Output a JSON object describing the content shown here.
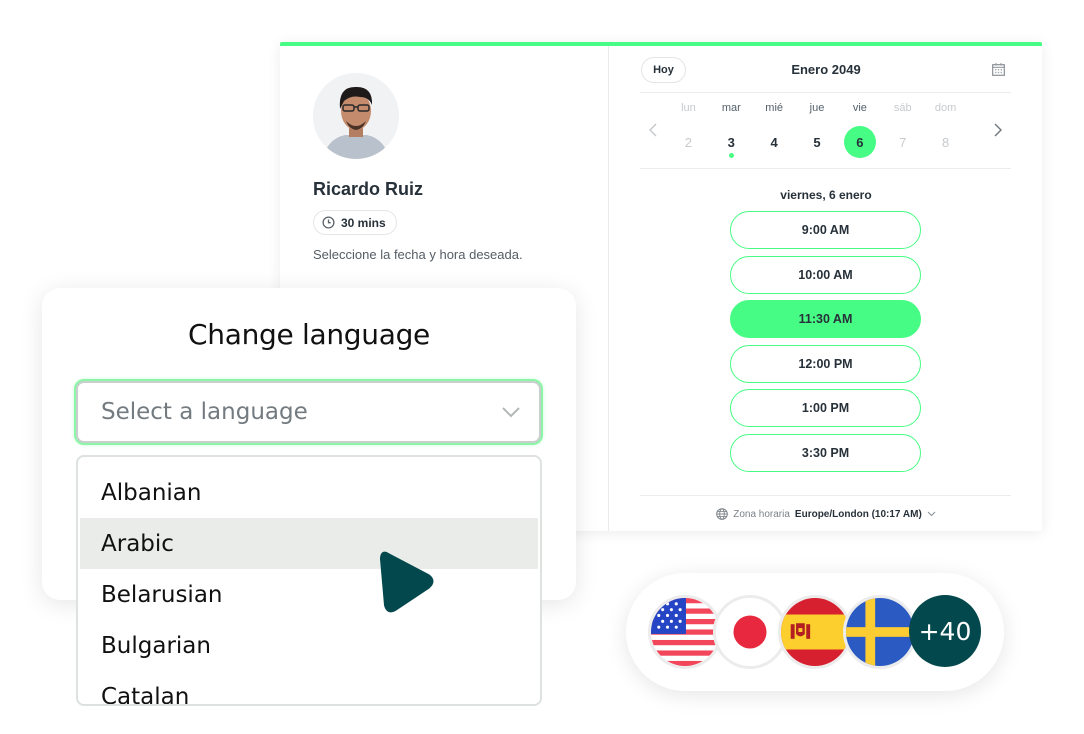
{
  "booking": {
    "host_name": "Ricardo Ruiz",
    "duration": "30 mins",
    "instructions": "Seleccione la fecha y hora deseada.",
    "today_label": "Hoy",
    "month_title": "Enero 2049",
    "week": [
      {
        "name": "lun",
        "num": "2",
        "state": "disabled"
      },
      {
        "name": "mar",
        "num": "3",
        "state": "today"
      },
      {
        "name": "mié",
        "num": "4",
        "state": "available"
      },
      {
        "name": "jue",
        "num": "5",
        "state": "available"
      },
      {
        "name": "vie",
        "num": "6",
        "state": "selected"
      },
      {
        "name": "sáb",
        "num": "7",
        "state": "disabled"
      },
      {
        "name": "dom",
        "num": "8",
        "state": "disabled"
      }
    ],
    "selected_date": "viernes, 6 enero",
    "slots": [
      {
        "label": "9:00 AM",
        "selected": false
      },
      {
        "label": "10:00 AM",
        "selected": false
      },
      {
        "label": "11:30 AM",
        "selected": true
      },
      {
        "label": "12:00 PM",
        "selected": false
      },
      {
        "label": "1:00 PM",
        "selected": false
      },
      {
        "label": "3:30 PM",
        "selected": false
      }
    ],
    "timezone_label": "Zona horaria",
    "timezone_value": "Europe/London (10:17 AM)"
  },
  "language": {
    "title": "Change language",
    "select_placeholder": "Select a language",
    "options": [
      "Albanian",
      "Arabic",
      "Belarusian",
      "Bulgarian",
      "Catalan"
    ],
    "hovered": "Arabic"
  },
  "flags": {
    "items": [
      "us-flag",
      "japan-flag",
      "spain-flag",
      "sweden-flag"
    ],
    "more_label": "+40"
  },
  "colors": {
    "accent": "#47fc84",
    "dark_teal": "#03484c"
  }
}
